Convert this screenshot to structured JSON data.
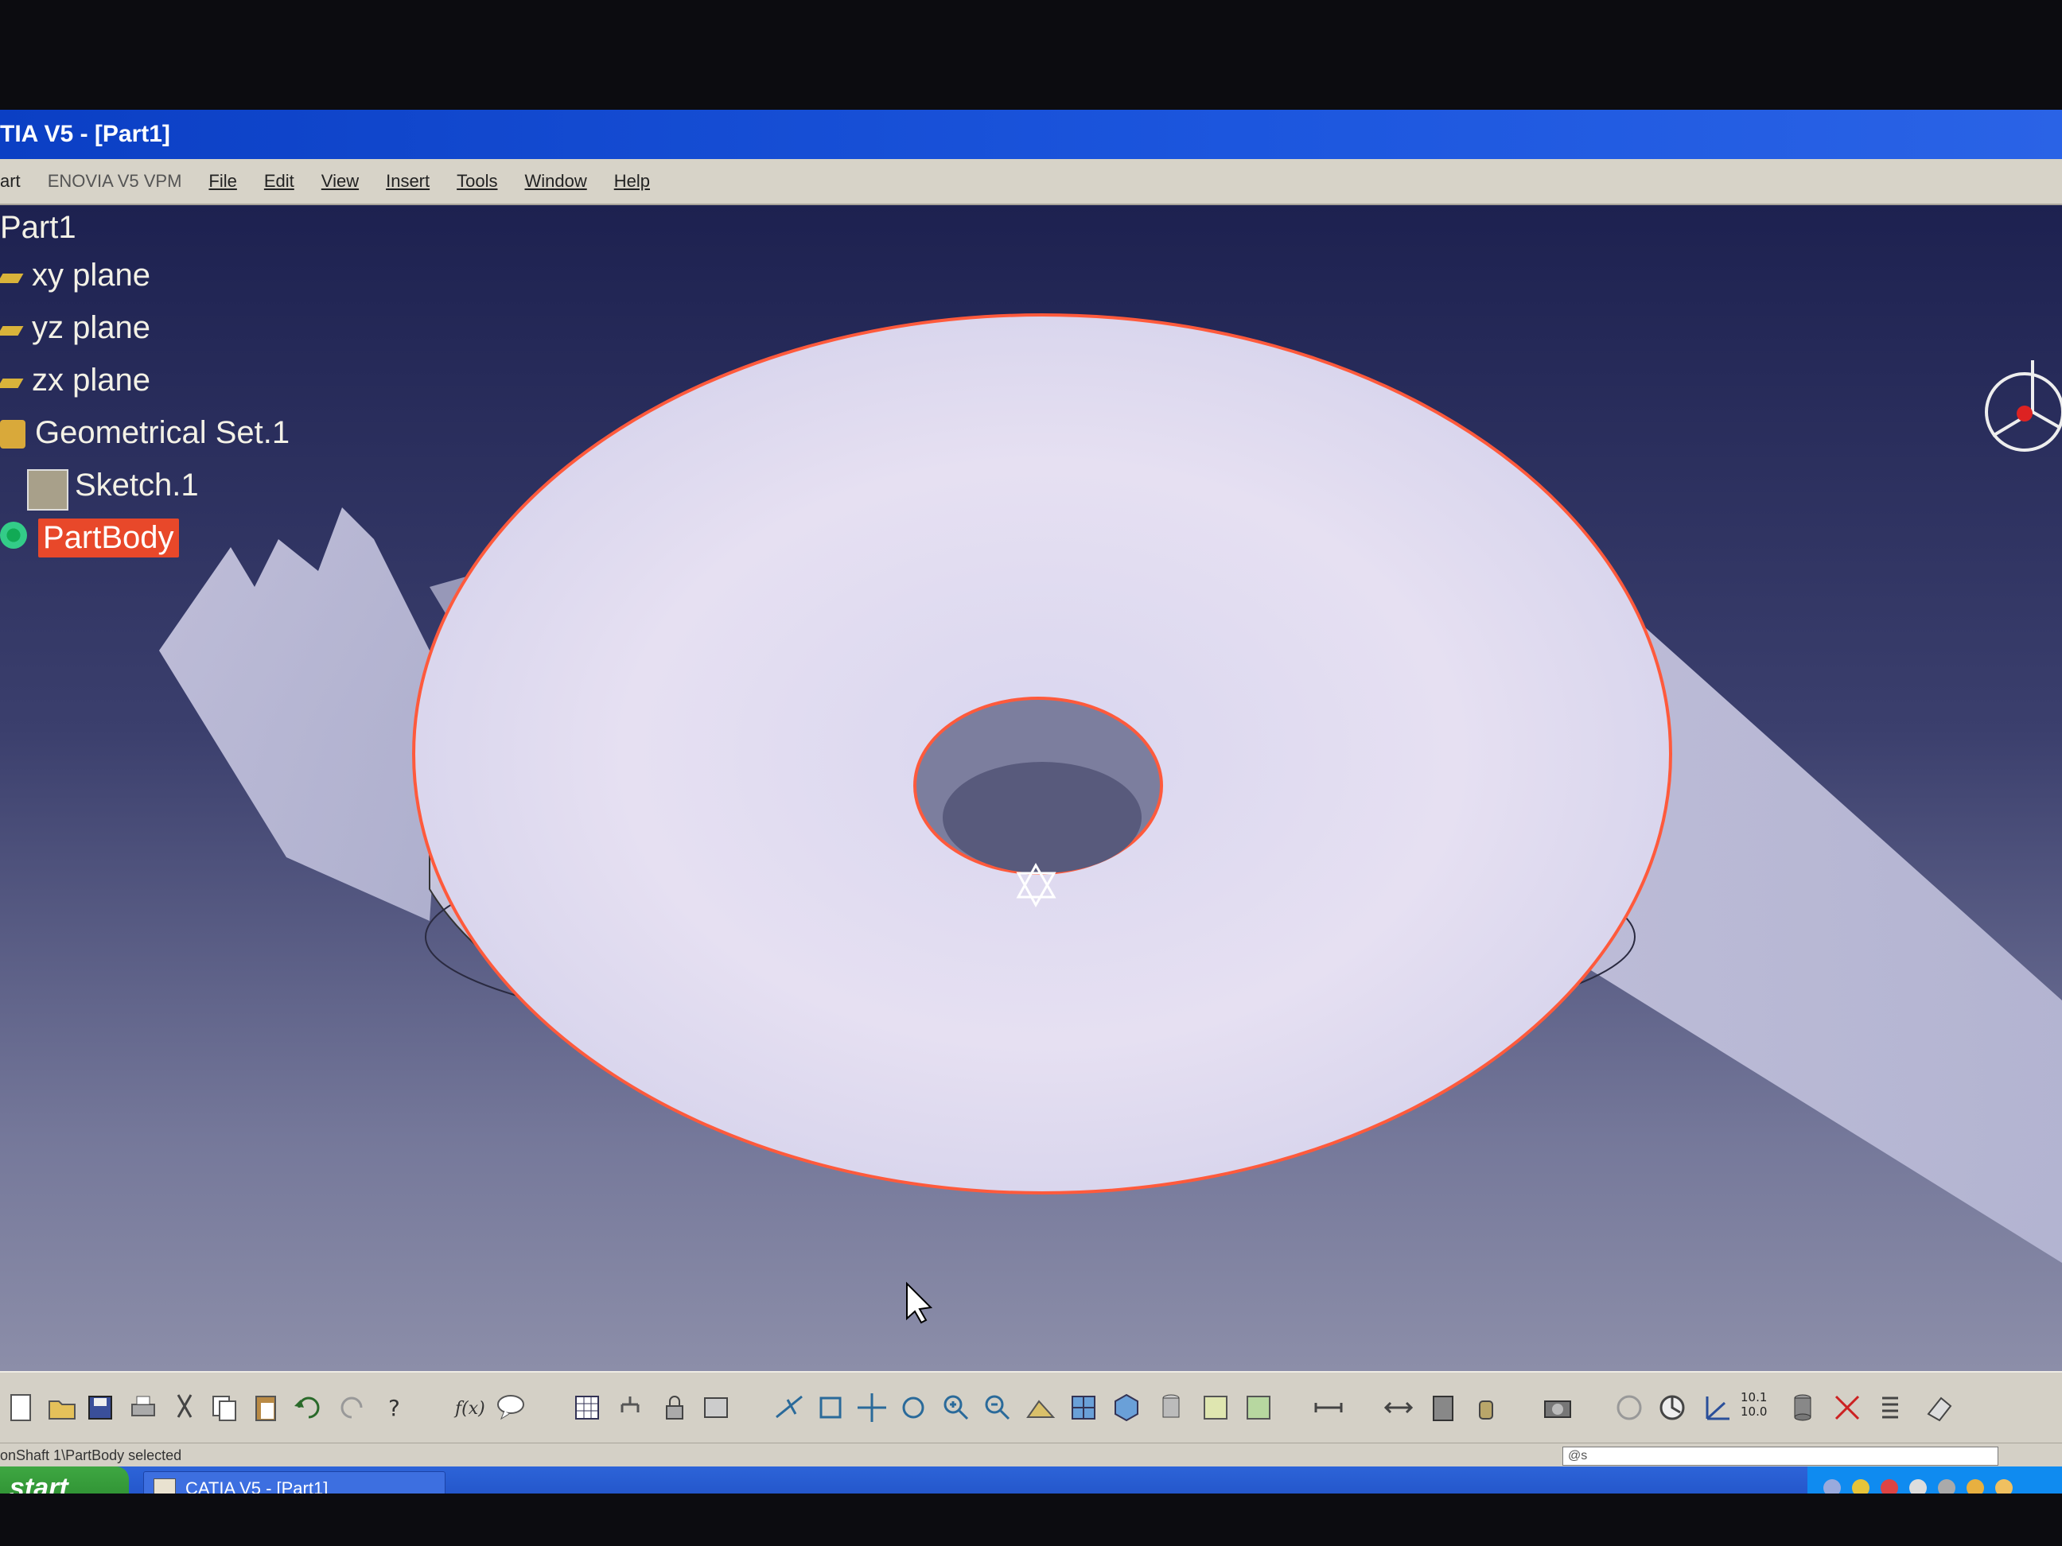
{
  "window": {
    "title": "TIA V5 - [Part1]"
  },
  "menubar": {
    "items": [
      "art",
      "ENOVIA V5 VPM",
      "File",
      "Edit",
      "View",
      "Insert",
      "Tools",
      "Window",
      "Help"
    ]
  },
  "tree": {
    "root": "Part1",
    "nodes": [
      "xy plane",
      "yz plane",
      "zx plane",
      "Geometrical Set.1",
      "Sketch.1",
      "PartBody"
    ],
    "selected": "PartBody"
  },
  "toolbar": {
    "buttons": [
      "new-icon",
      "open-icon",
      "save-icon",
      "print-icon",
      "cut-icon",
      "copy-icon",
      "paste-icon",
      "undo-icon",
      "redo-icon",
      "whats-this-icon",
      "formula-icon",
      "comment-icon",
      "table-icon",
      "tree-icon",
      "lock-icon",
      "catalog-icon",
      "fly-icon",
      "fit-all-icon",
      "pan-icon",
      "rotate-icon",
      "zoom-in-icon",
      "zoom-out-icon",
      "normal-view-icon",
      "multi-view-icon",
      "iso-view-icon",
      "shading-icon",
      "hide-show-icon",
      "swap-icon",
      "measure-between-icon",
      "measure-item-icon",
      "inertia-icon",
      "capture-icon",
      "update-icon",
      "analysis-icon",
      "axis-icon",
      "tolerance-icon",
      "cylinder-icon",
      "draft-icon",
      "list-icon",
      "eraser-icon"
    ],
    "tolerance_label": "10.1\n10.0"
  },
  "status": {
    "message": "onShaft 1\\PartBody selected",
    "power_input": "@s"
  },
  "taskbar": {
    "start": "start",
    "task": "CATIA V5 - [Part1]"
  },
  "colors": {
    "title_bar": "#1c56de",
    "selection": "#e8482a",
    "edge_highlight": "#ff5a3c"
  }
}
